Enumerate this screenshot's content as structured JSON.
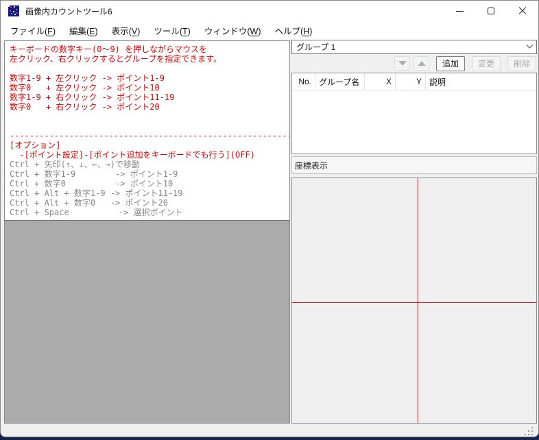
{
  "window": {
    "title": "画像内カウントツール6"
  },
  "menu": {
    "items": [
      {
        "pre": "ファイル(",
        "key": "F",
        "post": ")"
      },
      {
        "pre": "編集(",
        "key": "E",
        "post": ")"
      },
      {
        "pre": "表示(",
        "key": "V",
        "post": ")"
      },
      {
        "pre": "ツール(",
        "key": "T",
        "post": ")"
      },
      {
        "pre": "ウィンドウ(",
        "key": "W",
        "post": ")"
      },
      {
        "pre": "ヘルプ(",
        "key": "H",
        "post": ")"
      }
    ]
  },
  "left_panel": {
    "info_text": "キーボードの数字キー(0〜9) を押しながらマウスを\n左クリック、右クリックするとグループを指定できます。\n\n数字1-9 + 左クリック -> ポイント1-9\n数字0   + 左クリック -> ポイント10\n数字1-9 + 右クリック -> ポイント11-19\n数字0   + 右クリック -> ポイント20\n\n\n------------------------------------------------------------\n[オプション]\n  -[ポイント設定]-[ポイント追加をキーボードでも行う](OFF)",
    "shortcuts_text": "Ctrl + 矢印(↑、↓、←、→)で移動\nCtrl + 数字1-9        -> ポイント1-9\nCtrl + 数字0          -> ポイント10\nCtrl + Alt + 数字1-9 -> ポイント11-19\nCtrl + Alt + 数字0   -> ポイント20\nCtrl + Space          -> 選択ポイント"
  },
  "group_panel": {
    "selected_group": "グループ 1",
    "buttons": {
      "add": "追加",
      "edit": "変更",
      "delete": "削除"
    },
    "table": {
      "headers": [
        "No.",
        "グループ名",
        "X",
        "Y",
        "説明"
      ],
      "rows": []
    },
    "coords_label": "座標表示"
  },
  "icons": {
    "move_down": "triangle-down-icon",
    "move_up": "triangle-up-icon",
    "combo": "chevron-down-icon"
  },
  "colors": {
    "instruction_red": "#e00000",
    "shortcut_gray": "#878787",
    "canvas_gray": "#ababab",
    "crosshair_red": "#ee1111",
    "panel_bg": "#f0f0f0",
    "desktop_navy": "#14264e"
  }
}
